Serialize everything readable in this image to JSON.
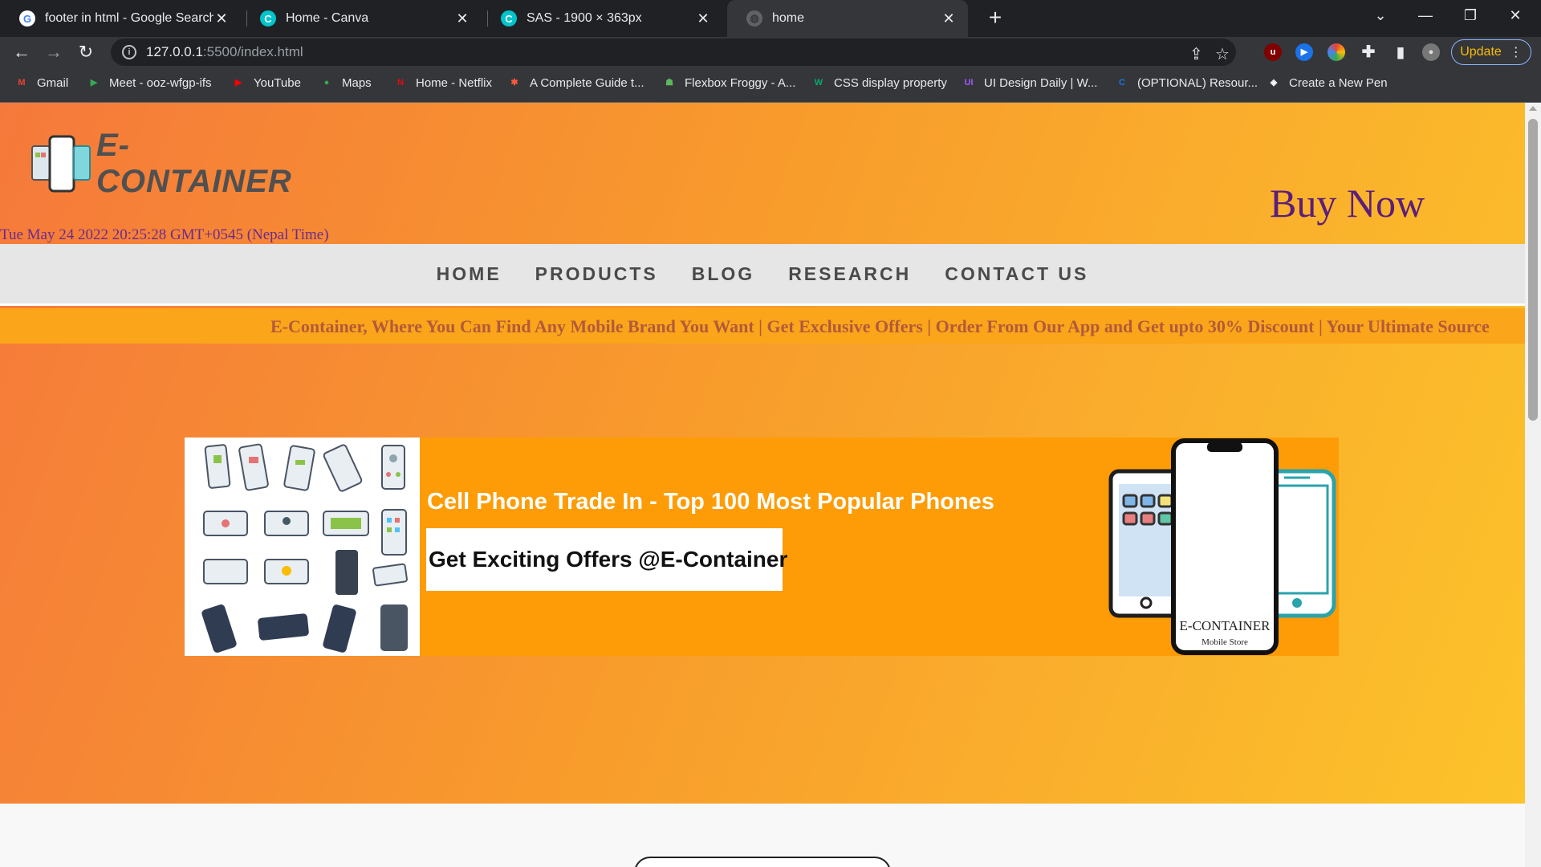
{
  "browser": {
    "tabs": [
      {
        "title": "footer in html - Google Search",
        "favicon": "google-icon",
        "active": false
      },
      {
        "title": "Home - Canva",
        "favicon": "canva-icon",
        "active": false
      },
      {
        "title": "SAS - 1900 × 363px",
        "favicon": "canva-icon",
        "active": false
      },
      {
        "title": "home",
        "favicon": "globe-icon",
        "active": true
      }
    ],
    "url_host": "127.0.0.1",
    "url_path": ":5500/index.html",
    "update_label": "Update",
    "bookmarks": [
      {
        "label": "Gmail",
        "icon": "gmail-icon",
        "color": "#ea4335",
        "glyph": "M"
      },
      {
        "label": "Meet - ooz-wfgp-ifs",
        "icon": "meet-icon",
        "color": "#34a853",
        "glyph": "▶"
      },
      {
        "label": "YouTube",
        "icon": "youtube-icon",
        "color": "#ff0000",
        "glyph": "▶"
      },
      {
        "label": "Maps",
        "icon": "maps-icon",
        "color": "#34a853",
        "glyph": "●"
      },
      {
        "label": "Home - Netflix",
        "icon": "netflix-icon",
        "color": "#e50914",
        "glyph": "N"
      },
      {
        "label": "A Complete Guide t...",
        "icon": "asterisk-icon",
        "color": "#ff5a3c",
        "glyph": "✱"
      },
      {
        "label": "Flexbox Froggy - A...",
        "icon": "frog-icon",
        "color": "#5cb85c",
        "glyph": "☗"
      },
      {
        "label": "CSS display property",
        "icon": "w3schools-icon",
        "color": "#04aa6d",
        "glyph": "W"
      },
      {
        "label": "UI Design Daily | W...",
        "icon": "uidesign-icon",
        "color": "#a259ff",
        "glyph": "UI"
      },
      {
        "label": "(OPTIONAL) Resour...",
        "icon": "c-icon",
        "color": "#1a73e8",
        "glyph": "C"
      },
      {
        "label": "Create a New Pen",
        "icon": "codepen-icon",
        "color": "#ffffff",
        "glyph": "◈"
      }
    ]
  },
  "page": {
    "logo_text": "E-CONTAINER",
    "buy_now": "Buy Now",
    "datetime": "Tue May 24 2022 20:25:28 GMT+0545 (Nepal Time)",
    "nav": [
      "HOME",
      "PRODUCTS",
      "BLOG",
      "RESEARCH",
      "CONTACT US"
    ],
    "marquee": "E-Container, Where You Can Find Any Mobile Brand You Want | Get Exclusive Offers | Order From Our App and Get upto 30% Discount | Your Ultimate Source",
    "banner": {
      "headline": "Cell Phone Trade In - Top 100 Most Popular Phones",
      "offer": "Get Exciting Offers @E-Container",
      "brand": "E-CONTAINER",
      "brand_sub": "Mobile Store"
    }
  },
  "colors": {
    "hero_gradient_start": "#f5793b",
    "hero_gradient_end": "#fcc32b",
    "buy_now": "#5b1e7b",
    "marquee_bg": "#fba51a",
    "banner_bg": "#fd9c06"
  }
}
